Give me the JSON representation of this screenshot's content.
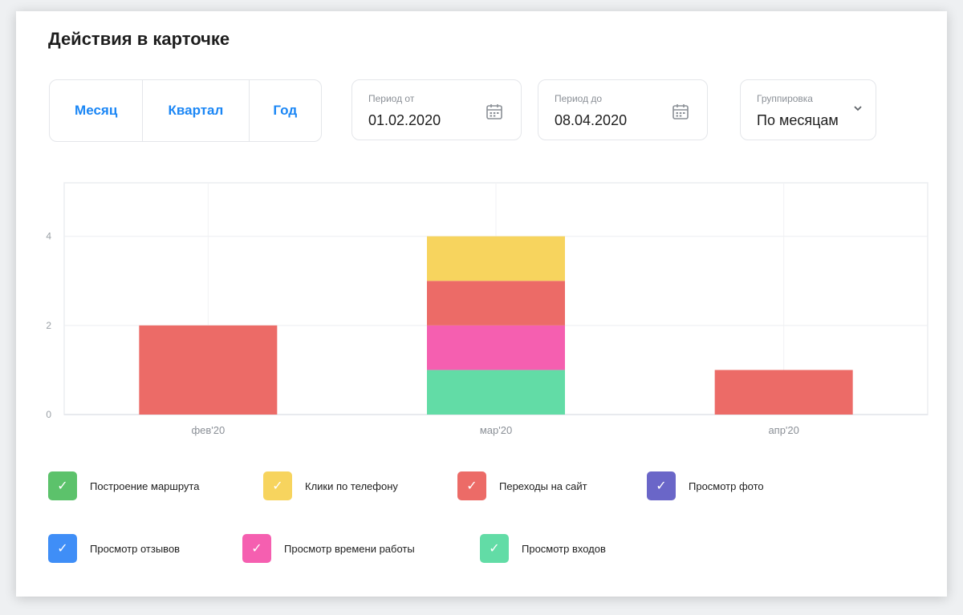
{
  "card": {
    "title": "Действия в карточке"
  },
  "period_buttons": [
    {
      "label": "Месяц"
    },
    {
      "label": "Квартал"
    },
    {
      "label": "Год"
    }
  ],
  "date_from": {
    "label": "Период от",
    "value": "01.02.2020",
    "icon": "calendar-icon"
  },
  "date_to": {
    "label": "Период до",
    "value": "08.04.2020",
    "icon": "calendar-icon"
  },
  "grouping": {
    "label": "Группировка",
    "value": "По месяцам",
    "icon": "chevron-down-icon"
  },
  "chart_data": {
    "type": "bar",
    "stacked": true,
    "categories": [
      "фев'20",
      "мар'20",
      "апр'20"
    ],
    "yticks": [
      0,
      2,
      4
    ],
    "ylim": [
      0,
      5.2
    ],
    "grid": true,
    "legend_position": "bottom",
    "series": [
      {
        "name": "Построение маршрута",
        "color": "#5cc26b",
        "values": [
          0,
          0,
          0
        ]
      },
      {
        "name": "Клики по телефону",
        "color": "#f7d45e",
        "values": [
          0,
          1,
          0
        ]
      },
      {
        "name": "Переходы на сайт",
        "color": "#ec6b67",
        "values": [
          2,
          1,
          1
        ]
      },
      {
        "name": "Просмотр фото",
        "color": "#6a66c8",
        "values": [
          0,
          0,
          0
        ]
      },
      {
        "name": "Просмотр отзывов",
        "color": "#3f8ef7",
        "values": [
          0,
          0,
          0
        ]
      },
      {
        "name": "Просмотр времени работы",
        "color": "#f55fb0",
        "values": [
          0,
          1,
          0
        ]
      },
      {
        "name": "Просмотр входов",
        "color": "#62dca6",
        "values": [
          0,
          1,
          0
        ]
      }
    ],
    "stack_order": [
      "Просмотр входов",
      "Просмотр времени работы",
      "Переходы на сайт",
      "Клики по телефону",
      "Построение маршрута",
      "Просмотр фото",
      "Просмотр отзывов"
    ]
  }
}
